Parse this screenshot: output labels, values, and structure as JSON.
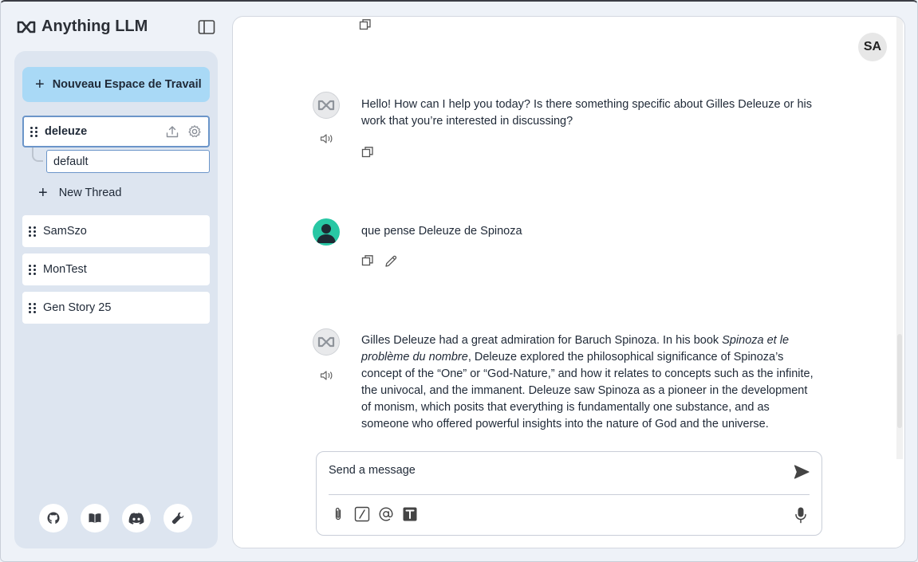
{
  "app": {
    "title": "Anything LLM"
  },
  "sidebar": {
    "new_workspace_label": "Nouveau Espace de Travail",
    "workspaces": [
      {
        "name": "deleuze",
        "active": true
      },
      {
        "name": "SamSzo"
      },
      {
        "name": "MonTest"
      },
      {
        "name": "Gen Story 25"
      }
    ],
    "threads": [
      {
        "name": "default"
      }
    ],
    "new_thread_label": "New Thread",
    "footer_icons": [
      "github-icon",
      "book-icon",
      "discord-icon",
      "wrench-icon"
    ]
  },
  "main": {
    "user_avatar": "SA",
    "messages": [
      {
        "role": "assistant",
        "text": "Hello! How can I help you today? Is there something specific about Gilles Deleuze or his work that you’re interested in discussing?"
      },
      {
        "role": "user",
        "text": "que pense Deleuze de Spinoza"
      },
      {
        "role": "assistant",
        "text_before": "Gilles Deleuze had a great admiration for Baruch Spinoza. In his book ",
        "text_italic": "Spinoza et le problème du nombre",
        "text_after": ", Deleuze explored the philosophical significance of Spinoza’s concept of the “One” or “God-Nature,” and how it relates to concepts such as the infinite, the univocal, and the immanent. Deleuze saw Spinoza as a pioneer in the development of monism, which posits that everything is fundamentally one substance, and as someone who offered powerful insights into the nature of God and the universe."
      }
    ],
    "composer": {
      "placeholder": "Send a message",
      "tools": [
        "paperclip-icon",
        "slash-command-icon",
        "at-mention-icon",
        "text-size-icon"
      ]
    }
  },
  "colors": {
    "new_workspace_bg": "#a9d9f6",
    "sidebar_bg": "#dde5f0",
    "user_avatar_bg": "#28c7a4",
    "active_border": "#6b95c9"
  }
}
